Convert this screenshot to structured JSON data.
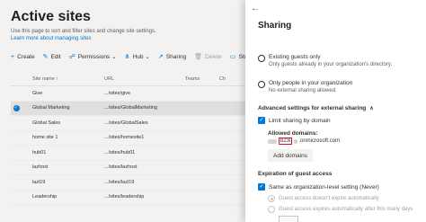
{
  "main": {
    "title": "Active sites",
    "description": "Use this page to sort and filter sites and change site settings.",
    "learn_more": "Learn more about managing sites",
    "toolbar": [
      {
        "icon": "plus-icon",
        "glyph": "+",
        "label": "Create",
        "disabled": false
      },
      {
        "icon": "edit-icon",
        "glyph": "✎",
        "label": "Edit",
        "disabled": false
      },
      {
        "icon": "people-icon",
        "glyph": "☍",
        "label": "Permissions",
        "chevron": "⌄",
        "disabled": false
      },
      {
        "icon": "hub-icon",
        "glyph": "⋔",
        "label": "Hub",
        "chevron": "⌄",
        "disabled": false
      },
      {
        "icon": "share-icon",
        "glyph": "↗",
        "label": "Sharing",
        "disabled": false
      },
      {
        "icon": "delete-icon",
        "glyph": "🗑",
        "label": "Delete",
        "disabled": true
      },
      {
        "icon": "storage-icon",
        "glyph": "▭",
        "label": "Storage",
        "disabled": false
      }
    ],
    "table": {
      "headers": {
        "name": "Site name ↑",
        "url": "URL",
        "teams": "Teams",
        "ch": "Ch"
      },
      "rows": [
        {
          "name": "Give",
          "url": ".../sites/give",
          "selected": false
        },
        {
          "name": "Global Marketing",
          "url": ".../sites/GlobalMarketing",
          "selected": true
        },
        {
          "name": "Global Sales",
          "url": ".../sites/GlobalSales",
          "selected": false
        },
        {
          "name": "home site 1",
          "url": ".../sites/homesite1",
          "selected": false
        },
        {
          "name": "hub01",
          "url": ".../sites/hub01",
          "selected": false
        },
        {
          "name": "lazhost",
          "url": ".../sites/lazhost",
          "selected": false
        },
        {
          "name": "lazl19",
          "url": ".../sites/lazl19",
          "selected": false
        },
        {
          "name": "Leadership",
          "url": ".../sites/leadership",
          "selected": false
        }
      ]
    }
  },
  "panel": {
    "back_glyph": "←",
    "title": "Sharing",
    "existing_guests": {
      "label": "Existing guests only",
      "sub": "Only guests already in your organization's directory."
    },
    "only_org": {
      "label": "Only people in your organization",
      "sub": "No external sharing allowed."
    },
    "advanced_head": "Advanced settings for external sharing",
    "advanced_chevron": "∧",
    "limit_label": "Limit sharing by domain",
    "allowed_domains_label": "Allowed domains:",
    "domain_highlight": "b23i",
    "domain_suffix": ".onmicrosoft.com",
    "add_domains": "Add domains",
    "expiration_head": "Expiration of guest access",
    "same_as_org": "Same as organization-level setting (Never)",
    "no_expire": "Guest access doesn't expire automatically",
    "expires_after": "Guest access expires automatically after this many days",
    "check_glyph": "✓"
  }
}
